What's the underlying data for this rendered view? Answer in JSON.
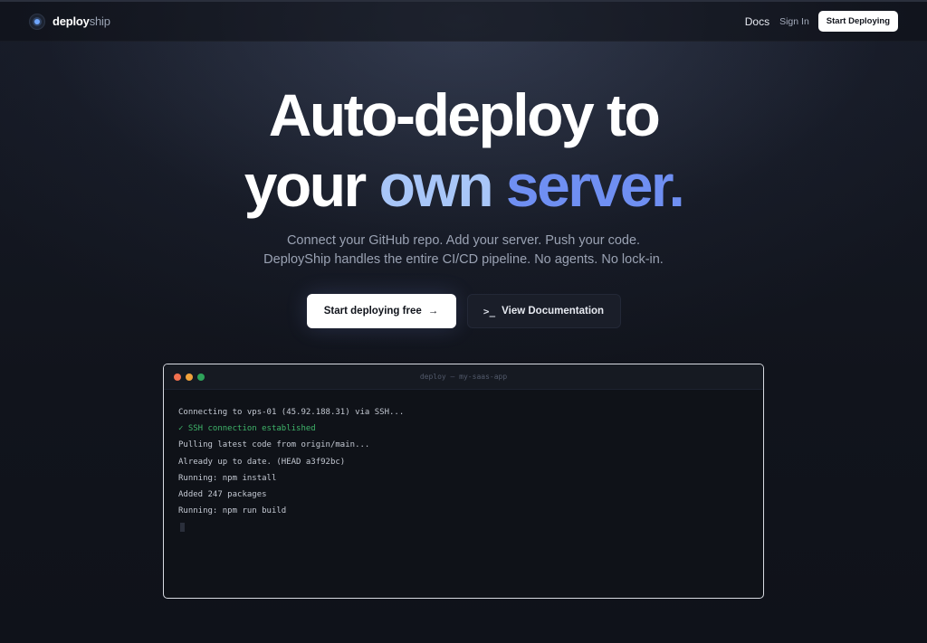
{
  "nav": {
    "brand_bold": "deploy",
    "brand_light": "ship",
    "docs": "Docs",
    "sign_in": "Sign In",
    "cta": "Start Deploying"
  },
  "hero": {
    "line1": "Auto-deploy to",
    "line2_word1": "your",
    "line2_word2": "own",
    "line2_word3": "server."
  },
  "subtitle": {
    "line1": "Connect your GitHub repo. Add your server. Push your code.",
    "line2": "DeployShip handles the entire CI/CD pipeline. No agents. No lock-in."
  },
  "buttons": {
    "primary": "Start deploying free",
    "primary_icon": "→",
    "secondary": "View Documentation",
    "secondary_icon": ">_"
  },
  "terminal": {
    "title": "deploy — my-saas-app",
    "lines": [
      "Connecting to vps-01 (45.92.188.31) via SSH...",
      "✓ SSH connection established",
      "Pulling latest code from origin/main...",
      "Already up to date. (HEAD a3f92bc)",
      "Running: npm install",
      "Added 247 packages",
      "Running: npm run build"
    ]
  },
  "colors": {
    "accent_light": "#a8c6f8",
    "accent": "#6f8ff2",
    "success": "#3fb56a",
    "background": "#12151f"
  }
}
